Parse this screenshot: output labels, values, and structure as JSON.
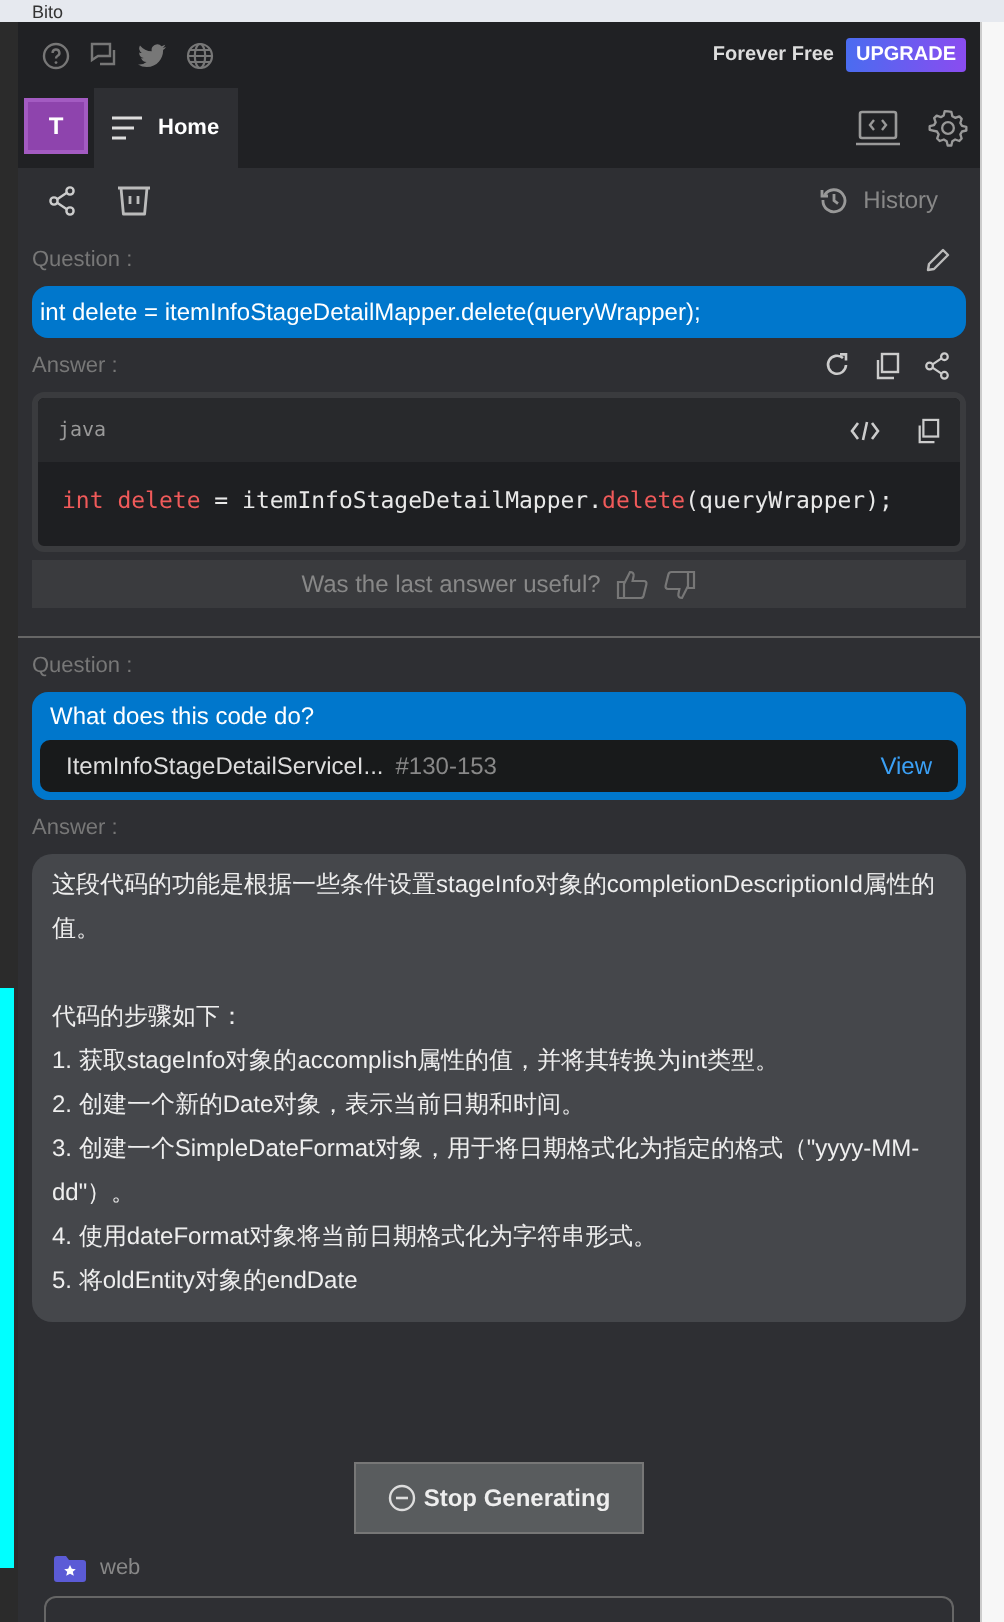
{
  "window": {
    "title": "Bito"
  },
  "top_bar": {
    "plan": "Forever Free",
    "upgrade": "UPGRADE"
  },
  "nav": {
    "avatar": "T",
    "tabs": [
      {
        "label": "Home",
        "selected": true
      }
    ]
  },
  "toolbar": {
    "history": "History"
  },
  "conversation": [
    {
      "kind": "code",
      "question_label": "Question :",
      "question": "int delete = itemInfoStageDetailMapper.delete(queryWrapper);",
      "answer_label": "Answer :",
      "language": "java",
      "code_tokens": [
        {
          "kind": "keyword",
          "text": "int"
        },
        {
          "kind": "keyword",
          "text": " delete"
        },
        {
          "kind": "plain",
          "text": " = itemInfoStageDetailMapper."
        },
        {
          "kind": "keyword",
          "text": "delete"
        },
        {
          "kind": "plain",
          "text": "(queryWrapper);"
        }
      ],
      "feedback": "Was the last answer useful?"
    },
    {
      "kind": "text",
      "question_label": "Question :",
      "question": "What does this code do?",
      "file": "ItemInfoStageDetailServiceI...",
      "lines": "#130-153",
      "view": "View",
      "answer_label": "Answer :",
      "intro": "这段代码的功能是根据一些条件设置stageInfo对象的completionDescriptionId属性的值。",
      "steps_heading": "代码的步骤如下：",
      "steps": [
        "1. 获取stageInfo对象的accomplish属性的值，并将其转换为int类型。",
        "2. 创建一个新的Date对象，表示当前日期和时间。",
        "3. 创建一个SimpleDateFormat对象，用于将日期格式化为指定的格式（\"yyyy-MM-dd\"）。",
        "4. 使用dateFormat对象将当前日期格式化为字符串形式。",
        "5. 将oldEntity对象的endDate"
      ]
    }
  ],
  "stop_button": "Stop Generating",
  "context": {
    "label": "web"
  }
}
